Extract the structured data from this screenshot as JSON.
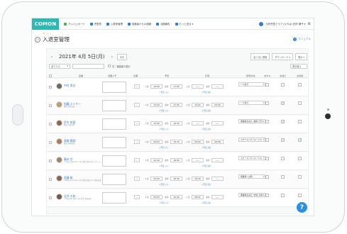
{
  "app": {
    "logo": "COMON"
  },
  "nav": {
    "items": [
      {
        "label": "ダッシュボード",
        "color": "#4caf50"
      },
      {
        "label": "児童表",
        "color": "#2d7fd1"
      },
      {
        "label": "入退室管理",
        "color": "#2d7fd1"
      },
      {
        "label": "保護者からの連絡",
        "color": "#2d7fd1"
      },
      {
        "label": "活動報告",
        "color": "#2d7fd1"
      },
      {
        "label": "もっと見る ▾",
        "color": "#2d7fd1"
      }
    ],
    "facility": "元町児童クラブ (ひろば) 田村 謙子 ▾"
  },
  "page": {
    "breadcrumb": "ホーム >",
    "title": "入退室管理",
    "manual": "マニュアル"
  },
  "datebar": {
    "date": "2021年 4月 5日(月)",
    "today": "今日",
    "btn_bulk": "全て出し登録",
    "btn_download": "ダウンロード ▾",
    "btn_display": "表示 ▾"
  },
  "filter": {
    "class_select": "全クラス",
    "search_placeholder": "",
    "checkbox_label": "欠・退園者も表示",
    "sort_select": "表示順 ▾"
  },
  "table": {
    "headers": {
      "name": "名前",
      "memo": "児童メモ",
      "absence": "欠席",
      "schedule": "予定",
      "actual": "打刻",
      "pickup": "帰宅方法",
      "snack": "おやつ",
      "transport": "お迎え",
      "lunch": "お弁当"
    },
    "labels": {
      "in": "入室",
      "out": "退室",
      "plan_link": "+予定 (入)",
      "plan_link2": "+予定 (退)"
    },
    "rows": [
      {
        "name": "中村 悠汰",
        "sub": "",
        "plan_in": "15:00",
        "plan_out": "17:00",
        "act_in": "--:--",
        "act_out": "--:--",
        "pickup": "一人帰り",
        "snack": false,
        "pickup_check": false,
        "lunch": false,
        "avatar": "#6b6b6b"
      },
      {
        "name": "加藤 エイミー",
        "sub": "養成 発達支援",
        "plan_in": "15:00",
        "plan_out": "17:00",
        "act_in": "15:00",
        "act_out": "09:09",
        "pickup": "一人帰り",
        "snack": false,
        "pickup_check": true,
        "lunch": false,
        "avatar": "#b89c7a"
      },
      {
        "name": "鈴木 結愛",
        "sub": "養成 発達支援",
        "plan_in": "15:00",
        "plan_out": "16:30",
        "act_in": "--:--",
        "act_out": "--:--",
        "pickup": "保護者お迎え (飛鳥 灯乃)",
        "snack": false,
        "pickup_check": true,
        "lunch": false,
        "avatar": "#8a6a52"
      },
      {
        "name": "高橋 陽翔",
        "sub": "養成 発達支援",
        "plan_in": "09:00",
        "plan_out": "15:30",
        "act_in": "09:00",
        "act_out": "08:48",
        "pickup": "スクールバス (ルート1)",
        "snack": false,
        "pickup_check": true,
        "lunch": true,
        "avatar": "#a57f60"
      },
      {
        "name": "藤本 空",
        "sub": "小学校 (unknown) 1年 保護 飛鳥 美月 スクール",
        "plan_in": "10:40",
        "plan_out": "16:00",
        "act_in": "--:--",
        "act_out": "--:--",
        "pickup": "スクールバス (ルート2)",
        "snack": false,
        "pickup_check": false,
        "lunch": false,
        "avatar": "#9c8470"
      },
      {
        "name": "佐藤 新",
        "sub": "小学校 (unknown) 2年 保護 佐藤 京子 発達支援",
        "plan_in": "15:30",
        "plan_out": "16:45",
        "act_in": "16:30",
        "act_out": "--:--",
        "pickup": "保護者 (父親)",
        "snack": false,
        "pickup_check": false,
        "lunch": false,
        "avatar": "#7d6a5a"
      },
      {
        "name": "吉井 大和",
        "sub": "小学校 2年 保護 吉井 美奈 発達支援",
        "plan_in": "09:00",
        "plan_out": "15:00",
        "act_in": "08:51",
        "act_out": "--:--",
        "pickup": "保護者お迎え (吉井 大和)",
        "snack": false,
        "pickup_check": false,
        "lunch": false,
        "avatar": "#6f5c4d"
      }
    ]
  },
  "colors": {
    "accent": "#2eb8b3",
    "link": "#2d7fd1",
    "help": "#2d8fe0"
  }
}
